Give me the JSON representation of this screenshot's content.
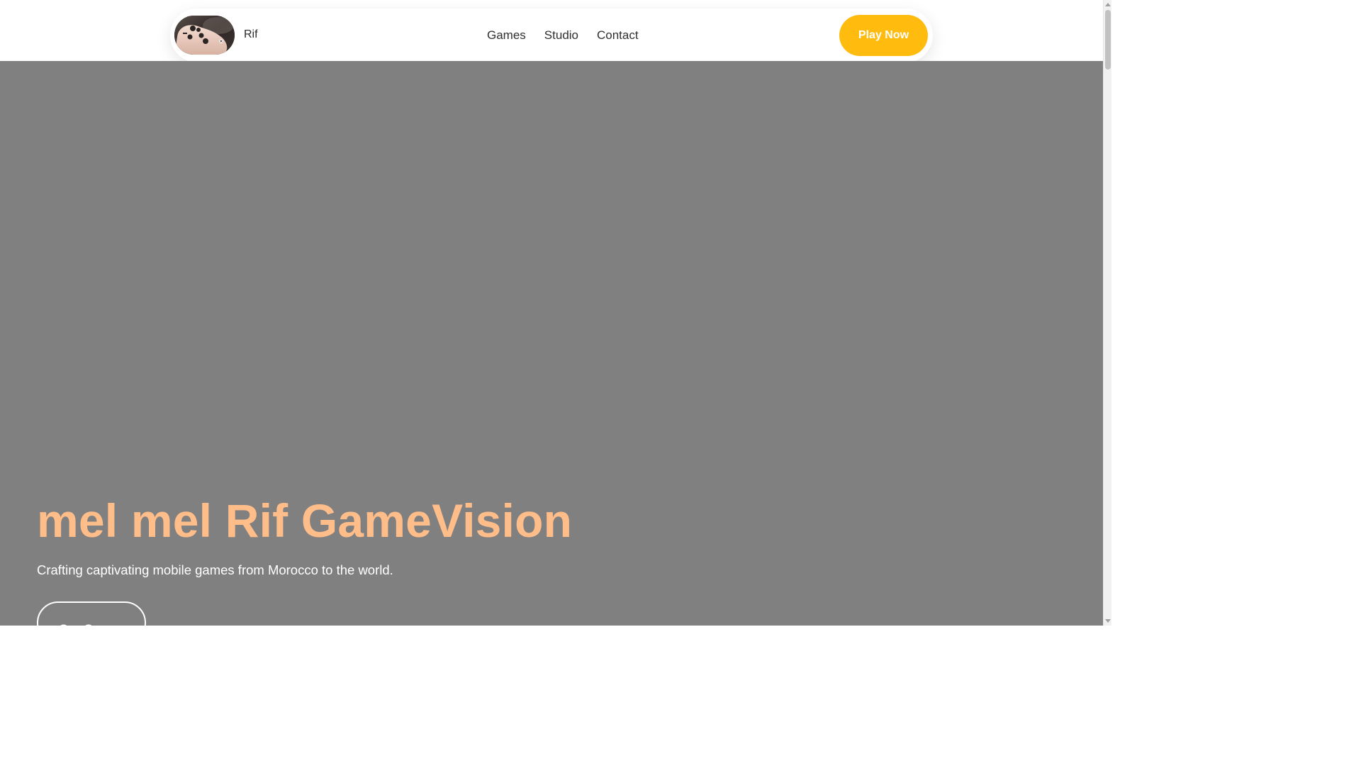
{
  "header": {
    "brand_name": "Rif",
    "logo_icon": "game-controller-photo",
    "nav": [
      {
        "label": "Games"
      },
      {
        "label": "Studio"
      },
      {
        "label": "Contact"
      }
    ],
    "cta_label": "Play Now"
  },
  "hero": {
    "title": "mel mel Rif GameVision",
    "subtitle": "Crafting captivating mobile games from Morocco to the world.",
    "button_label": "Our Games"
  },
  "colors": {
    "accent": "#ffbb0e",
    "hero_title": "#ffbd8a",
    "hero_bg": "#808080"
  }
}
